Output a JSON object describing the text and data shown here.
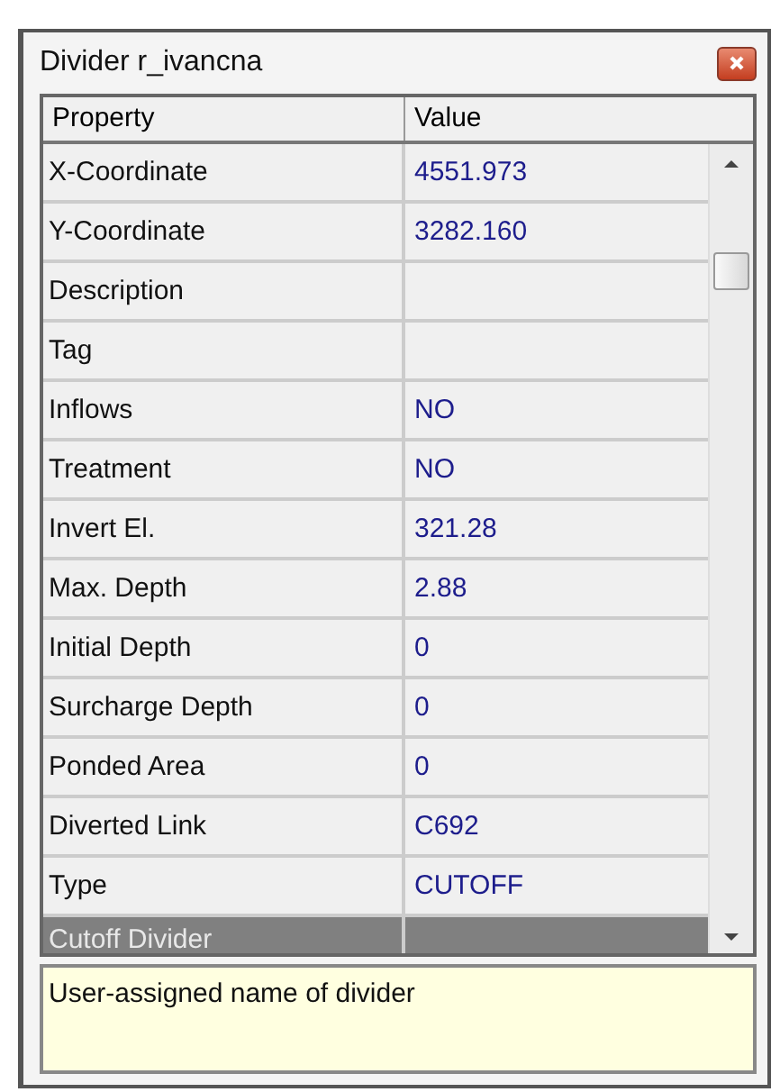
{
  "window": {
    "title": "Divider r_ivancna"
  },
  "table": {
    "columns": [
      "Property",
      "Value"
    ],
    "rows": [
      {
        "property": "X-Coordinate",
        "value": "4551.973",
        "selected": false
      },
      {
        "property": "Y-Coordinate",
        "value": "3282.160",
        "selected": false
      },
      {
        "property": "Description",
        "selected": false
      },
      {
        "property": "Tag",
        "selected": false
      },
      {
        "property": "Inflows",
        "value": "NO",
        "selected": false
      },
      {
        "property": "Treatment",
        "value": "NO",
        "selected": false
      },
      {
        "property": "Invert El.",
        "value": "321.28",
        "selected": false
      },
      {
        "property": "Max. Depth",
        "value": "2.88",
        "selected": false
      },
      {
        "property": "Initial Depth",
        "value": "0",
        "selected": false
      },
      {
        "property": "Surcharge Depth",
        "value": "0",
        "selected": false
      },
      {
        "property": "Ponded Area",
        "value": "0",
        "selected": false
      },
      {
        "property": "Diverted Link",
        "value": "C692",
        "selected": false
      },
      {
        "property": "Type",
        "value": "CUTOFF",
        "selected": false
      },
      {
        "property": "Cutoff Divider",
        "selected": true
      }
    ]
  },
  "description": "User-assigned name of divider"
}
